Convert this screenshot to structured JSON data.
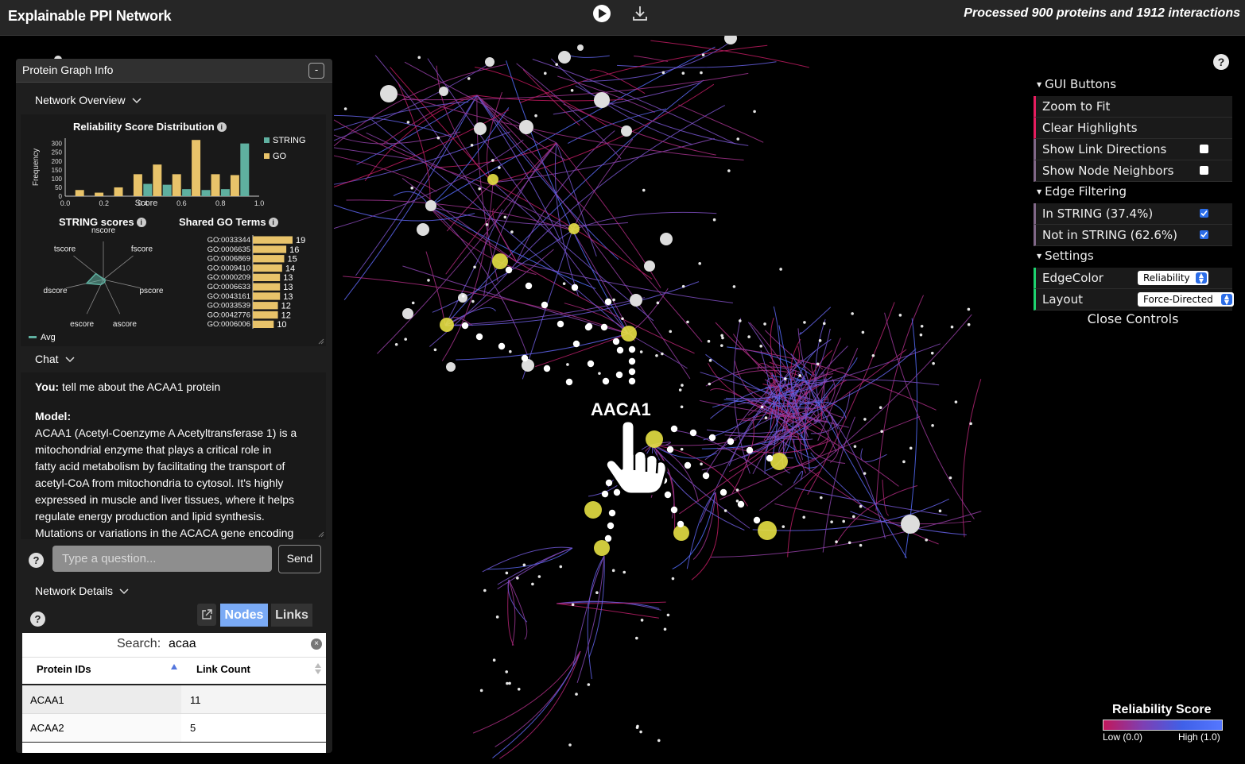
{
  "app": {
    "title": "Explainable PPI Network",
    "status": "Processed 900 proteins and 1912 interactions"
  },
  "toolbar": {
    "play_icon": "play-icon",
    "download_icon": "download-icon"
  },
  "graph": {
    "hover_label": "AACA1"
  },
  "gui": {
    "folders": {
      "buttons": "GUI Buttons",
      "edge_filtering": "Edge Filtering",
      "settings": "Settings"
    },
    "zoom_to_fit": "Zoom to Fit",
    "clear_highlights": "Clear Highlights",
    "show_link_directions": {
      "label": "Show Link Directions",
      "checked": false
    },
    "show_node_neighbors": {
      "label": "Show Node Neighbors",
      "checked": false
    },
    "in_string": {
      "label": "In STRING (37.4%)",
      "checked": true
    },
    "not_in_string": {
      "label": "Not in STRING (62.6%)",
      "checked": true
    },
    "edge_color": {
      "label": "EdgeColor",
      "value": "Reliability"
    },
    "layout": {
      "label": "Layout",
      "value": "Force-Directed"
    },
    "close": "Close Controls"
  },
  "legend": {
    "title": "Reliability Score",
    "low": "Low (0.0)",
    "high": "High (1.0)",
    "colors": [
      "#c2185b",
      "#7e3fb3",
      "#3f60e8",
      "#5577ff"
    ]
  },
  "panel": {
    "title": "Protein Graph Info",
    "collapse": "-",
    "sections": {
      "overview": "Network Overview",
      "chat": "Chat",
      "details": "Network Details"
    }
  },
  "chart_data": [
    {
      "type": "bar",
      "title": "Reliability Score Distribution",
      "xlabel": "Score",
      "ylabel": "Frequency",
      "xlim": [
        0.0,
        1.0
      ],
      "ylim": [
        0,
        330
      ],
      "xticks": [
        "0.0",
        "0.2",
        "0.4",
        "0.6",
        "0.8",
        "1.0"
      ],
      "yticks": [
        "0",
        "50",
        "100",
        "150",
        "200",
        "250",
        "300"
      ],
      "bin_centers": [
        0.05,
        0.15,
        0.25,
        0.35,
        0.45,
        0.55,
        0.65,
        0.75,
        0.85,
        0.95
      ],
      "series": [
        {
          "name": "STRING",
          "color": "#5fb0a0",
          "values": [
            0,
            0,
            0,
            0,
            70,
            65,
            40,
            35,
            40,
            300
          ]
        },
        {
          "name": "GO",
          "color": "#e8c36a",
          "values": [
            35,
            20,
            50,
            125,
            180,
            125,
            320,
            125,
            120,
            0
          ]
        }
      ]
    },
    {
      "type": "radar",
      "title": "STRING scores",
      "axes": [
        "nscore",
        "fscore",
        "pscore",
        "ascore",
        "escore",
        "dscore",
        "tscore"
      ],
      "series": [
        {
          "name": "Avg",
          "color": "#5fb0a0",
          "values": [
            0.02,
            0.03,
            0.05,
            0.08,
            0.15,
            0.45,
            0.25
          ]
        }
      ]
    },
    {
      "type": "bar",
      "orientation": "horizontal",
      "title": "Shared GO Terms",
      "categories": [
        "GO:0033344",
        "GO:0006635",
        "GO:0006869",
        "GO:0009410",
        "GO:0000209",
        "GO:0006633",
        "GO:0043161",
        "GO:0033539",
        "GO:0042776",
        "GO:0006006"
      ],
      "values": [
        19,
        16,
        15,
        14,
        13,
        13,
        13,
        12,
        12,
        10
      ],
      "color": "#e8c36a"
    }
  ],
  "chat": {
    "user_label": "You:",
    "user_message": "tell me about the ACAA1 protein",
    "model_label": "Model:",
    "model_lines": [
      "ACAA1 (Acetyl-Coenzyme A Acetyltransferase 1) is a",
      "mitochondrial enzyme that plays a critical role in",
      "fatty acid metabolism by facilitating the transport of",
      "acetyl-CoA from mitochondria to cytosol. It's highly",
      "expressed in muscle and liver tissues, where it helps",
      "regulate energy production and lipid synthesis.",
      "Mutations or variations in the ACACA gene encoding"
    ],
    "input_placeholder": "Type a question...",
    "send_label": "Send",
    "help": "?"
  },
  "details": {
    "help": "?",
    "tabs": {
      "nodes": "Nodes",
      "links": "Links"
    },
    "search_label": "Search:",
    "search_value": "acaa",
    "columns": [
      "Protein IDs",
      "Link Count"
    ],
    "rows": [
      {
        "id": "ACAA1",
        "count": "11"
      },
      {
        "id": "ACAA2",
        "count": "5"
      }
    ]
  },
  "help_top": "?"
}
